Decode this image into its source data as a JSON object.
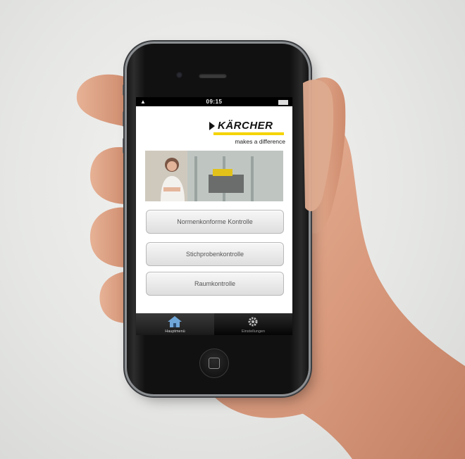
{
  "status_bar": {
    "time": "09:15"
  },
  "app": {
    "brand": "KÄRCHER",
    "tagline": "makes a difference",
    "buttons": [
      {
        "label": "Normenkonforme Kontrolle"
      },
      {
        "label": "Stichprobenkontrolle"
      },
      {
        "label": "Raumkontrolle"
      }
    ],
    "tabs": [
      {
        "label": "Hauptmenü",
        "icon": "home-icon"
      },
      {
        "label": "Einstellungen",
        "icon": "gear-icon"
      }
    ]
  },
  "colors": {
    "brand_yellow": "#f4d400",
    "background": "#e6e7e5"
  }
}
